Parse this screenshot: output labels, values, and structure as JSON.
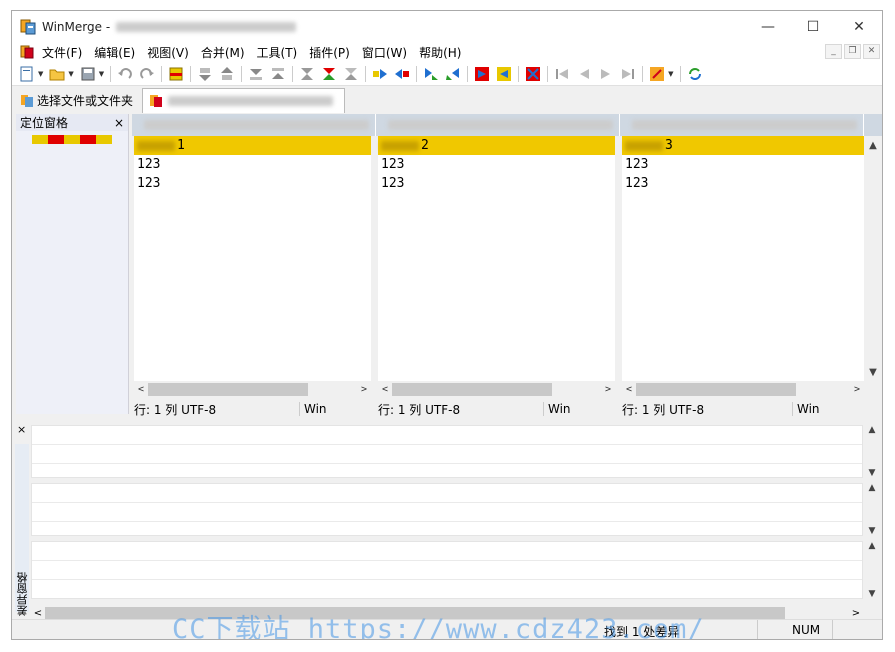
{
  "window": {
    "title": "WinMerge -",
    "controls": {
      "minimize": "—",
      "maximize": "☐",
      "close": "✕"
    }
  },
  "menubar": {
    "items": [
      "文件(F)",
      "编辑(E)",
      "视图(V)",
      "合并(M)",
      "工具(T)",
      "插件(P)",
      "窗口(W)",
      "帮助(H)"
    ],
    "mdi": {
      "minimize": "_",
      "restore": "❐",
      "close": "✕"
    }
  },
  "toolbar": {
    "icons": [
      "new-file-icon",
      "open-folder-icon",
      "save-icon",
      "undo-icon",
      "redo-icon",
      "options-icon",
      "next-diff-icon",
      "prev-diff-icon",
      "first-diff-icon",
      "last-diff-icon",
      "current-diff-icon",
      "next-conflict-icon",
      "prev-conflict-icon",
      "copy-right-icon",
      "copy-left-icon",
      "copy-right-advance-icon",
      "copy-left-advance-icon",
      "copy-to-right-icon",
      "copy-to-left-icon",
      "all-right-icon",
      "first-bookmark-icon",
      "prev-bookmark-icon",
      "next-bookmark-icon",
      "last-bookmark-icon",
      "edit-icon",
      "refresh-icon"
    ]
  },
  "tabs": [
    {
      "label": "选择文件或文件夹",
      "icon": "winmerge-icon"
    },
    {
      "label": "",
      "icon": "merge-doc-icon"
    }
  ],
  "location_pane": {
    "title": "定位窗格",
    "close": "×",
    "map_colors": [
      "#e8c800",
      "#e00000",
      "#e8c800",
      "#e00000",
      "#e8c800"
    ]
  },
  "panes": [
    {
      "lines": [
        {
          "text": "1",
          "diff": true
        },
        {
          "text": "123",
          "diff": false
        },
        {
          "text": "123",
          "diff": false
        }
      ],
      "status": {
        "position": "行: 1  列",
        "encoding": "UTF-8",
        "eol": "Win"
      }
    },
    {
      "lines": [
        {
          "text": "2",
          "diff": true
        },
        {
          "text": "123",
          "diff": false
        },
        {
          "text": "123",
          "diff": false
        }
      ],
      "status": {
        "position": "行: 1  列",
        "encoding": "UTF-8",
        "eol": "Win"
      }
    },
    {
      "lines": [
        {
          "text": "3",
          "diff": true
        },
        {
          "text": "123",
          "diff": false
        },
        {
          "text": "123",
          "diff": false
        }
      ],
      "status": {
        "position": "行: 1  列",
        "encoding": "UTF-8",
        "eol": "Win"
      }
    }
  ],
  "diff_pane": {
    "title": "差异窗格",
    "close": "×"
  },
  "statusbar": {
    "message": "找到 1 处差异",
    "num": "NUM"
  },
  "watermark": "CC下载站 https://www.cdz423.com/",
  "colors": {
    "diff": "#f0c800",
    "header": "#cfd8e2",
    "accent": "#e00000"
  }
}
